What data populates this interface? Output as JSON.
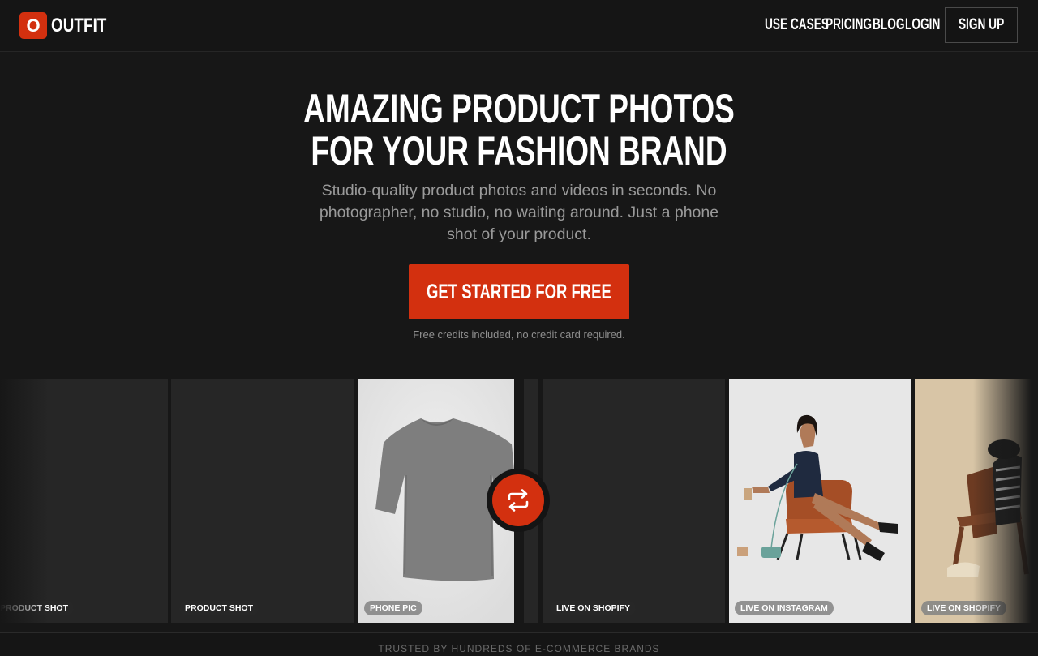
{
  "brand": {
    "mark": "O",
    "name": "OUTFIT",
    "accent": "#d3300f"
  },
  "nav": {
    "links": [
      "USE CASES",
      "PRICING",
      "BLOG",
      "LOGIN"
    ],
    "signup": "SIGN UP"
  },
  "hero": {
    "title_line1": "AMAZING PRODUCT PHOTOS",
    "title_line2": "FOR YOUR FASHION BRAND",
    "subtitle": "Studio-quality product photos and videos in seconds. No photographer, no studio, no waiting around. Just a phone shot of your product.",
    "cta": "GET STARTED FOR FREE",
    "cta_note": "Free credits included, no credit card required."
  },
  "gallery": {
    "cards": [
      {
        "label": "PRODUCT SHOT"
      },
      {
        "label": "PRODUCT SHOT"
      },
      {
        "label": "PHONE PIC"
      },
      {
        "label": "LIVE ON SHOPIFY"
      },
      {
        "label": "LIVE ON INSTAGRAM"
      },
      {
        "label": "LIVE ON SHOPIFY"
      }
    ],
    "swap_icon": "swap-arrows-icon"
  },
  "trusted_text": "TRUSTED BY HUNDREDS OF E-COMMERCE BRANDS"
}
